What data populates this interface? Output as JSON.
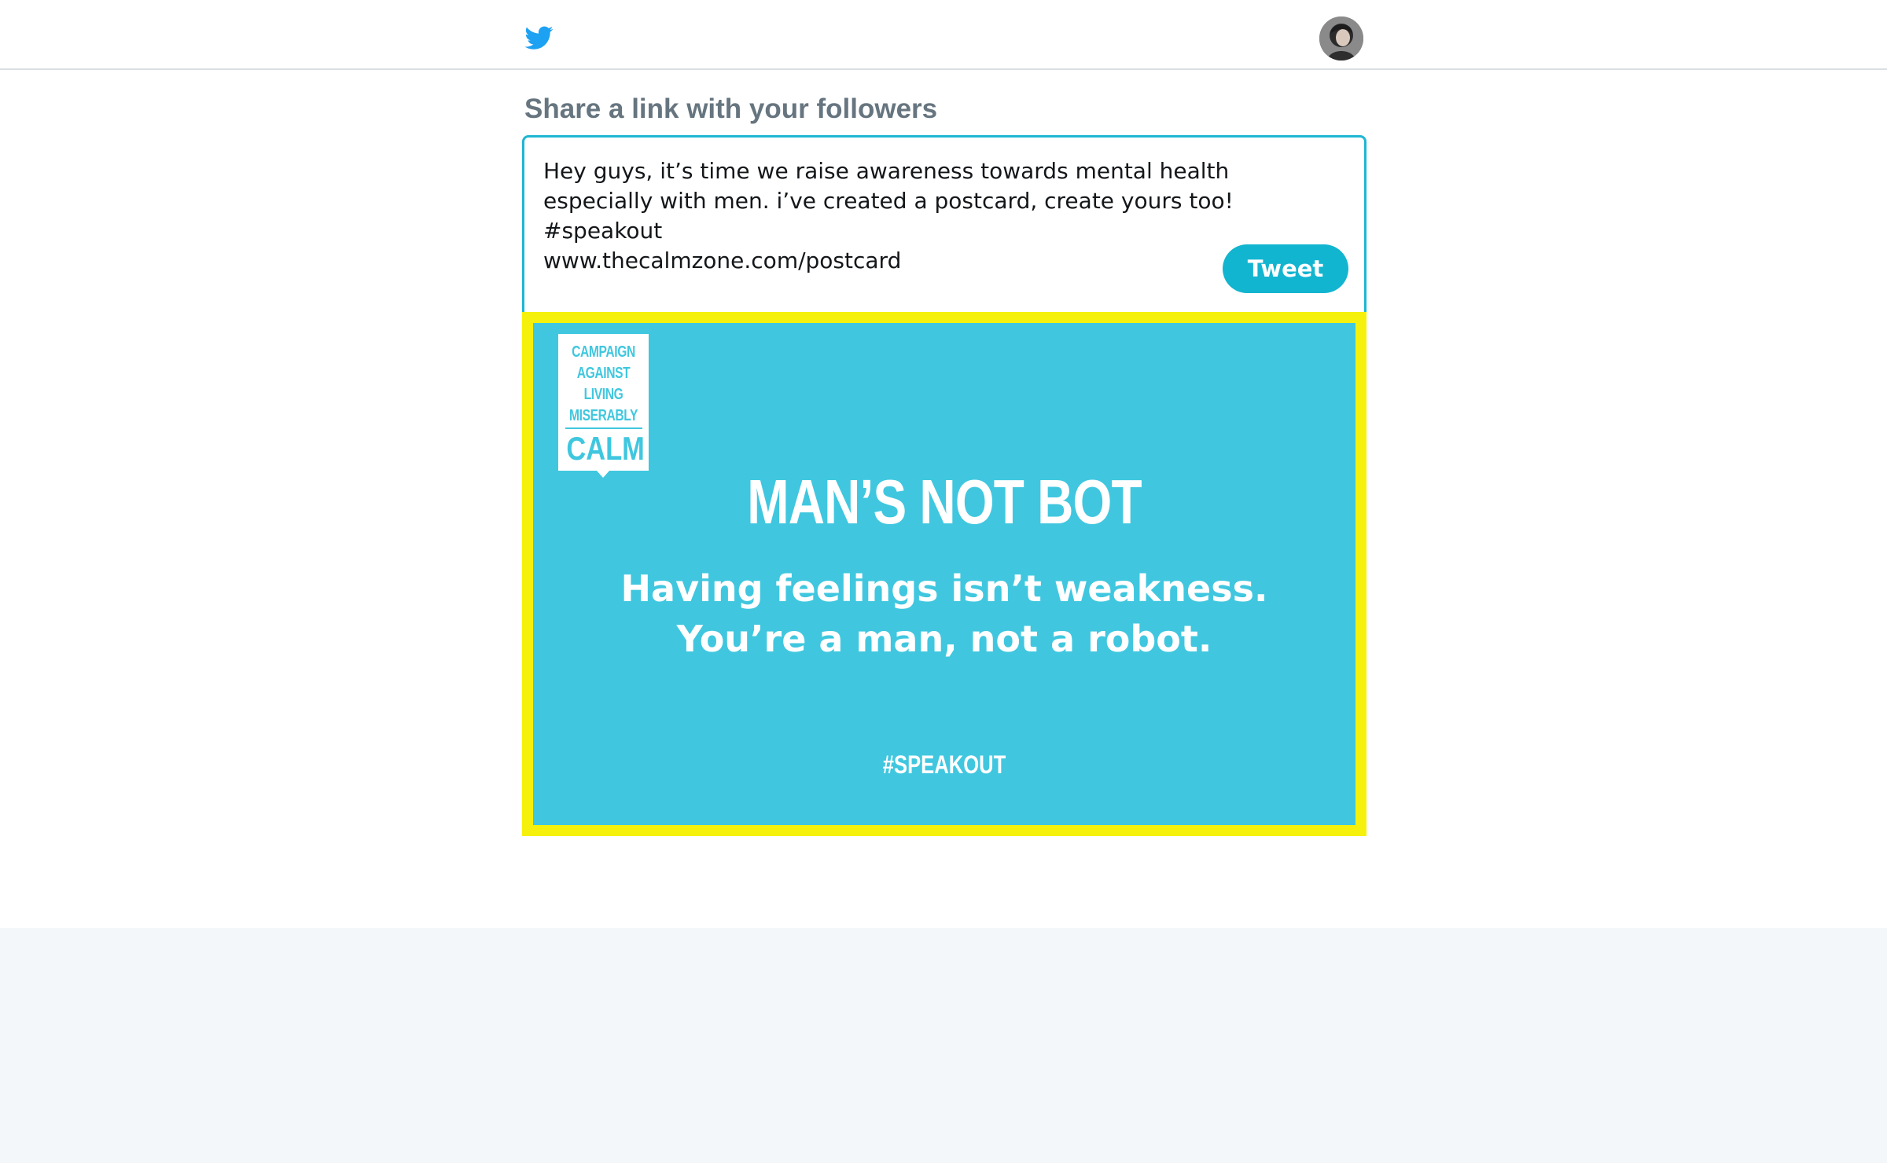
{
  "header": {
    "logo_icon": "twitter-bird-icon",
    "brand_color": "#1da1f2",
    "avatar_icon": "user-avatar"
  },
  "share": {
    "title": "Share a link with your followers"
  },
  "composer": {
    "text": "Hey guys, it’s time we raise awareness towards mental health especially with men. i’ve created a postcard, create yours too! #speakout",
    "url": "www.thecalmzone.com/postcard",
    "tweet_label": "Tweet",
    "accent": "#1fb6d3"
  },
  "postcard": {
    "logo_lines": [
      "CAMPAIGN",
      "AGAINST",
      "LIVING",
      "MISERABLY"
    ],
    "logo_brand": "CALM",
    "headline": "MAN’S NOT BOT",
    "line1": "Having feelings isn’t weakness.",
    "line2": "You’re a man, not a robot.",
    "hashtag": "#SPEAKOUT",
    "background": "#40c7df",
    "highlight": "#f5f10c"
  }
}
